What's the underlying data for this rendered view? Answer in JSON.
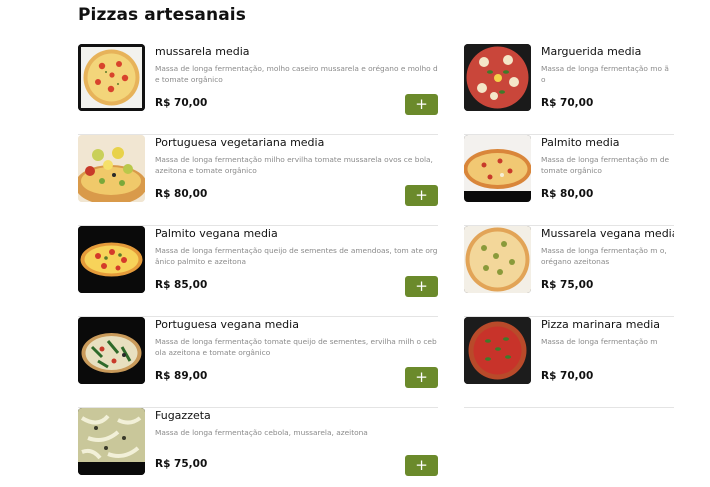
{
  "section": {
    "title": "Pizzas artesanais"
  },
  "add_label": "+",
  "colors": {
    "accent": "#6b8a2b",
    "text": "#111111",
    "muted": "#8a8a8a",
    "divider": "#e4e4e4"
  },
  "left_items": [
    {
      "name": "mussarela media",
      "description": "Massa de longa fermentação, molho caseiro mussarela e orégano e molho de tomate orgânico",
      "price": "R$ 70,00",
      "image": "pizza-mussarela"
    },
    {
      "name": "Portuguesa vegetariana media",
      "description": "Massa de longa fermentação milho ervilha tomate mussarela ovos ce bola, azeitona e tomate orgânico",
      "price": "R$ 80,00",
      "image": "pizza-portuguesa-vegetariana"
    },
    {
      "name": "Palmito vegana media",
      "description": "Massa de longa fermentação queijo de sementes de amendoas, tom ate orgânico palmito e azeitona",
      "price": "R$ 85,00",
      "image": "pizza-palmito-vegana"
    },
    {
      "name": "Portuguesa vegana media",
      "description": "Massa de longa fermentação tomate queijo de sementes, ervilha milh o cebola azeitona e tomate orgânico",
      "price": "R$ 89,00",
      "image": "pizza-portuguesa-vegana"
    },
    {
      "name": "Fugazzeta",
      "description": "Massa de longa fermentação cebola, mussarela, azeitona",
      "price": "R$ 75,00",
      "image": "pizza-fugazzeta"
    }
  ],
  "right_items": [
    {
      "name": "Marguerida media",
      "description": "Massa de longa fermentação mo ão",
      "price": "R$ 70,00",
      "image": "pizza-marguerida"
    },
    {
      "name": "Palmito media",
      "description": "Massa de longa fermentação m de tomate orgânico",
      "price": "R$ 80,00",
      "image": "pizza-palmito"
    },
    {
      "name": "Mussarela vegana media",
      "description": "Massa de longa fermentação m o, orégano azeitonas",
      "price": "R$ 75,00",
      "image": "pizza-mussarela-vegana"
    },
    {
      "name": "Pizza marinara media",
      "description": "Massa de longa fermentação m",
      "price": "R$ 70,00",
      "image": "pizza-marinara"
    }
  ]
}
